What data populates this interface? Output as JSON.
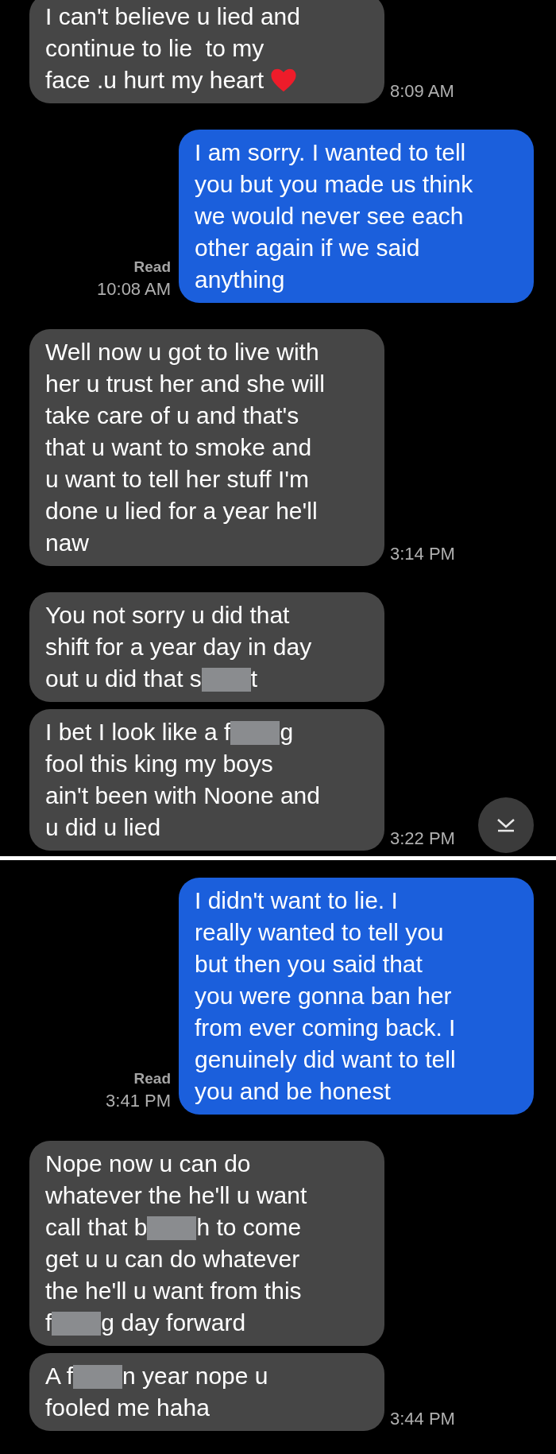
{
  "sections": [
    {
      "messages": [
        {
          "kind": "received",
          "lines": [
            "I can't believe u lied and",
            "continue to lie  to my",
            [
              {
                "kind": "text",
                "text": "face .u hurt my heart"
              },
              {
                "kind": "heart"
              }
            ]
          ],
          "time": "8:09 AM"
        },
        {
          "kind": "sent",
          "status": "Read",
          "time": "10:08 AM",
          "lines": [
            "I am sorry. I wanted to tell",
            "you but you made us think",
            "we would never see each",
            "other again if we said",
            "anything"
          ]
        },
        {
          "kind": "received",
          "lines": [
            "Well now u got to live with",
            "her u trust her and she will",
            "take care of u and that's",
            "that u want to smoke and",
            "u want to tell her stuff I'm",
            "done u lied for a year he'll",
            "naw"
          ],
          "time": "3:14 PM"
        },
        {
          "kind": "received",
          "lines": [
            "You not sorry u did that",
            "shift for a year day in day",
            [
              {
                "kind": "text",
                "text": "out u did that s"
              },
              {
                "kind": "redaction"
              },
              {
                "kind": "text",
                "text": "t"
              }
            ]
          ]
        },
        {
          "kind": "received",
          "lines": [
            [
              {
                "kind": "text",
                "text": "I bet I look like a f"
              },
              {
                "kind": "redaction"
              },
              {
                "kind": "text",
                "text": "g"
              }
            ],
            "fool this king my boys",
            "ain't been with Noone and",
            "u did u lied"
          ],
          "time": "3:22 PM"
        }
      ]
    },
    {
      "messages": [
        {
          "kind": "sent",
          "status": "Read",
          "time": "3:41 PM",
          "lines": [
            "I didn't want to lie. I",
            "really wanted to tell you",
            "but then you said that",
            "you were gonna ban her",
            "from ever coming back. I",
            "genuinely did want to tell",
            "you and be honest"
          ]
        },
        {
          "kind": "received",
          "lines": [
            "Nope now u can do",
            "whatever the he'll u want",
            [
              {
                "kind": "text",
                "text": "call that b"
              },
              {
                "kind": "redaction"
              },
              {
                "kind": "text",
                "text": "h to come"
              }
            ],
            "get u u can do whatever",
            "the he'll u want from this",
            [
              {
                "kind": "text",
                "text": "f"
              },
              {
                "kind": "redaction"
              },
              {
                "kind": "text",
                "text": "g day forward"
              }
            ]
          ]
        },
        {
          "kind": "received",
          "lines": [
            [
              {
                "kind": "text",
                "text": "A f"
              },
              {
                "kind": "redaction"
              },
              {
                "kind": "text",
                "text": "n year nope u"
              }
            ],
            "fooled me haha"
          ],
          "time": "3:44 PM"
        }
      ]
    }
  ]
}
